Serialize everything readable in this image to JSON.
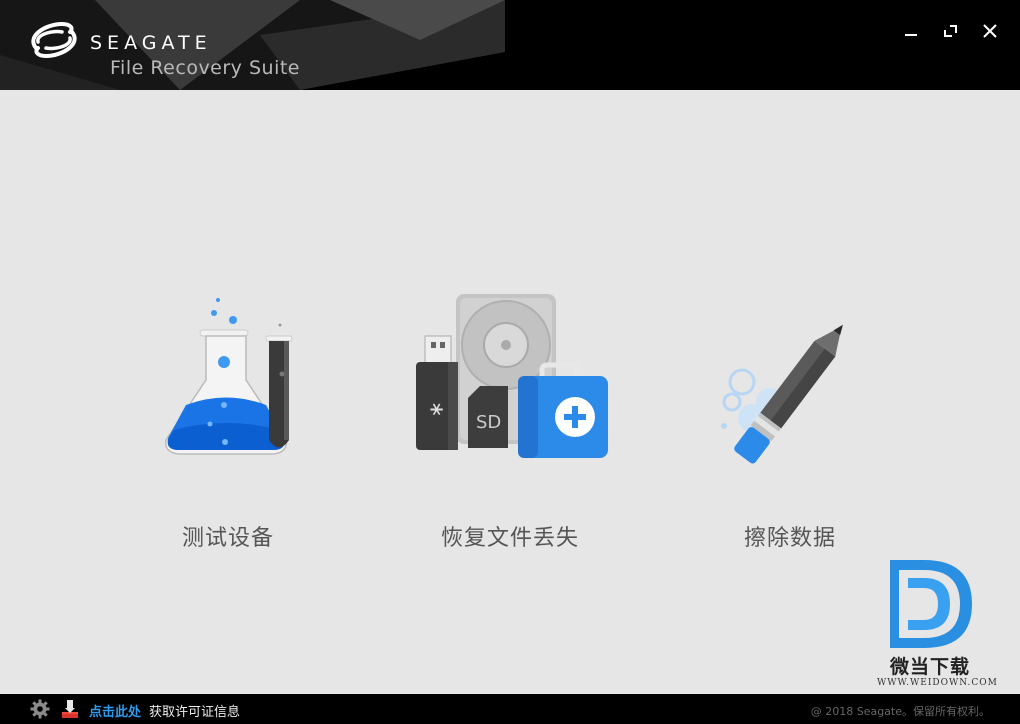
{
  "header": {
    "brand_name": "SEAGATE",
    "product_name": "File Recovery Suite",
    "controls": {
      "minimize": "minimize-icon",
      "maximize": "maximize-icon",
      "close": "close-icon"
    }
  },
  "options": [
    {
      "label": "测试设备",
      "icon": "flask-icon"
    },
    {
      "label": "恢复文件丢失",
      "icon": "recovery-icon"
    },
    {
      "label": "擦除数据",
      "icon": "eraser-icon"
    }
  ],
  "watermark": {
    "title": "微当下载",
    "url": "WWW.WEIDOWN.COM"
  },
  "footer": {
    "link_text": "点击此处",
    "text": "获取许可证信息",
    "copyright": "@ 2018 Seagate。保留所有权利。"
  },
  "colors": {
    "accent": "#2e9bf0",
    "header_bg": "#000000",
    "body_bg": "#e6e6e6",
    "footer_bg": "#000000"
  }
}
